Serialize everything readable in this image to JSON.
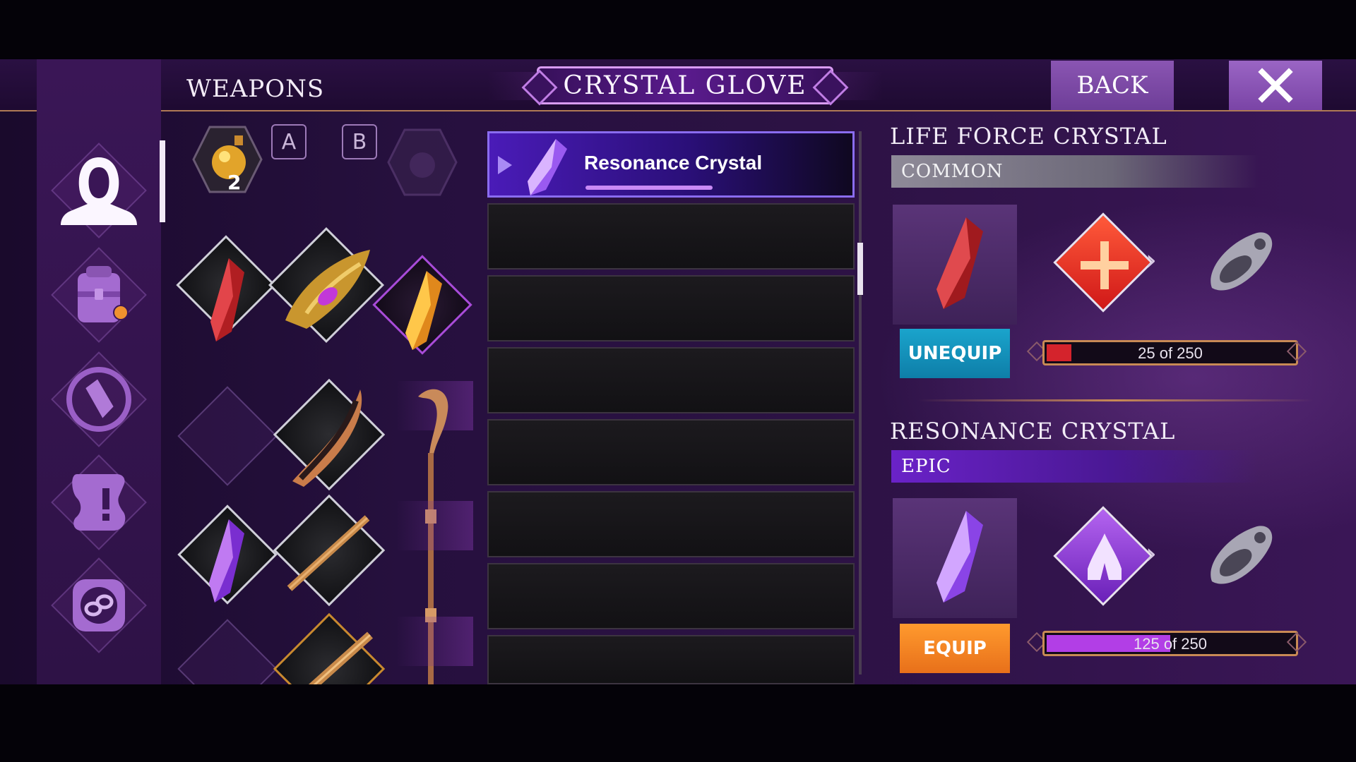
{
  "header": {
    "section_title": "WEAPONS",
    "item_title": "CRYSTAL GLOVE",
    "back_label": "BACK",
    "close_icon": "close-x-icon"
  },
  "sidenav": {
    "items": [
      {
        "icon": "hooded-character-icon",
        "active": true
      },
      {
        "icon": "backpack-icon",
        "notification": true
      },
      {
        "icon": "crystal-icon"
      },
      {
        "icon": "quest-scroll-icon"
      },
      {
        "icon": "link-chain-icon"
      }
    ]
  },
  "loadout": {
    "potion_count": "2",
    "tab_a": "A",
    "tab_b": "B"
  },
  "list": {
    "items": [
      {
        "label": "Resonance Crystal",
        "selected": true
      },
      {
        "label": ""
      },
      {
        "label": ""
      },
      {
        "label": ""
      },
      {
        "label": ""
      },
      {
        "label": ""
      },
      {
        "label": ""
      },
      {
        "label": ""
      }
    ]
  },
  "equipped": {
    "title": "LIFE FORCE CRYSTAL",
    "rarity": "COMMON",
    "action_label": "UNEQUIP",
    "progress_text": "25 of 250",
    "progress_value": 25,
    "progress_max": 250,
    "bar_color": "#d4232c"
  },
  "selected": {
    "title": "RESONANCE CRYSTAL",
    "rarity": "EPIC",
    "action_label": "EQUIP",
    "progress_text": "125 of 250",
    "progress_value": 125,
    "progress_max": 250,
    "bar_color": "#b23ee6"
  },
  "colors": {
    "accent_purple": "#8a55b2",
    "unequip_blue": "#1aa4cc",
    "equip_orange": "#ff9a2e",
    "notification_orange": "#f0922e"
  }
}
